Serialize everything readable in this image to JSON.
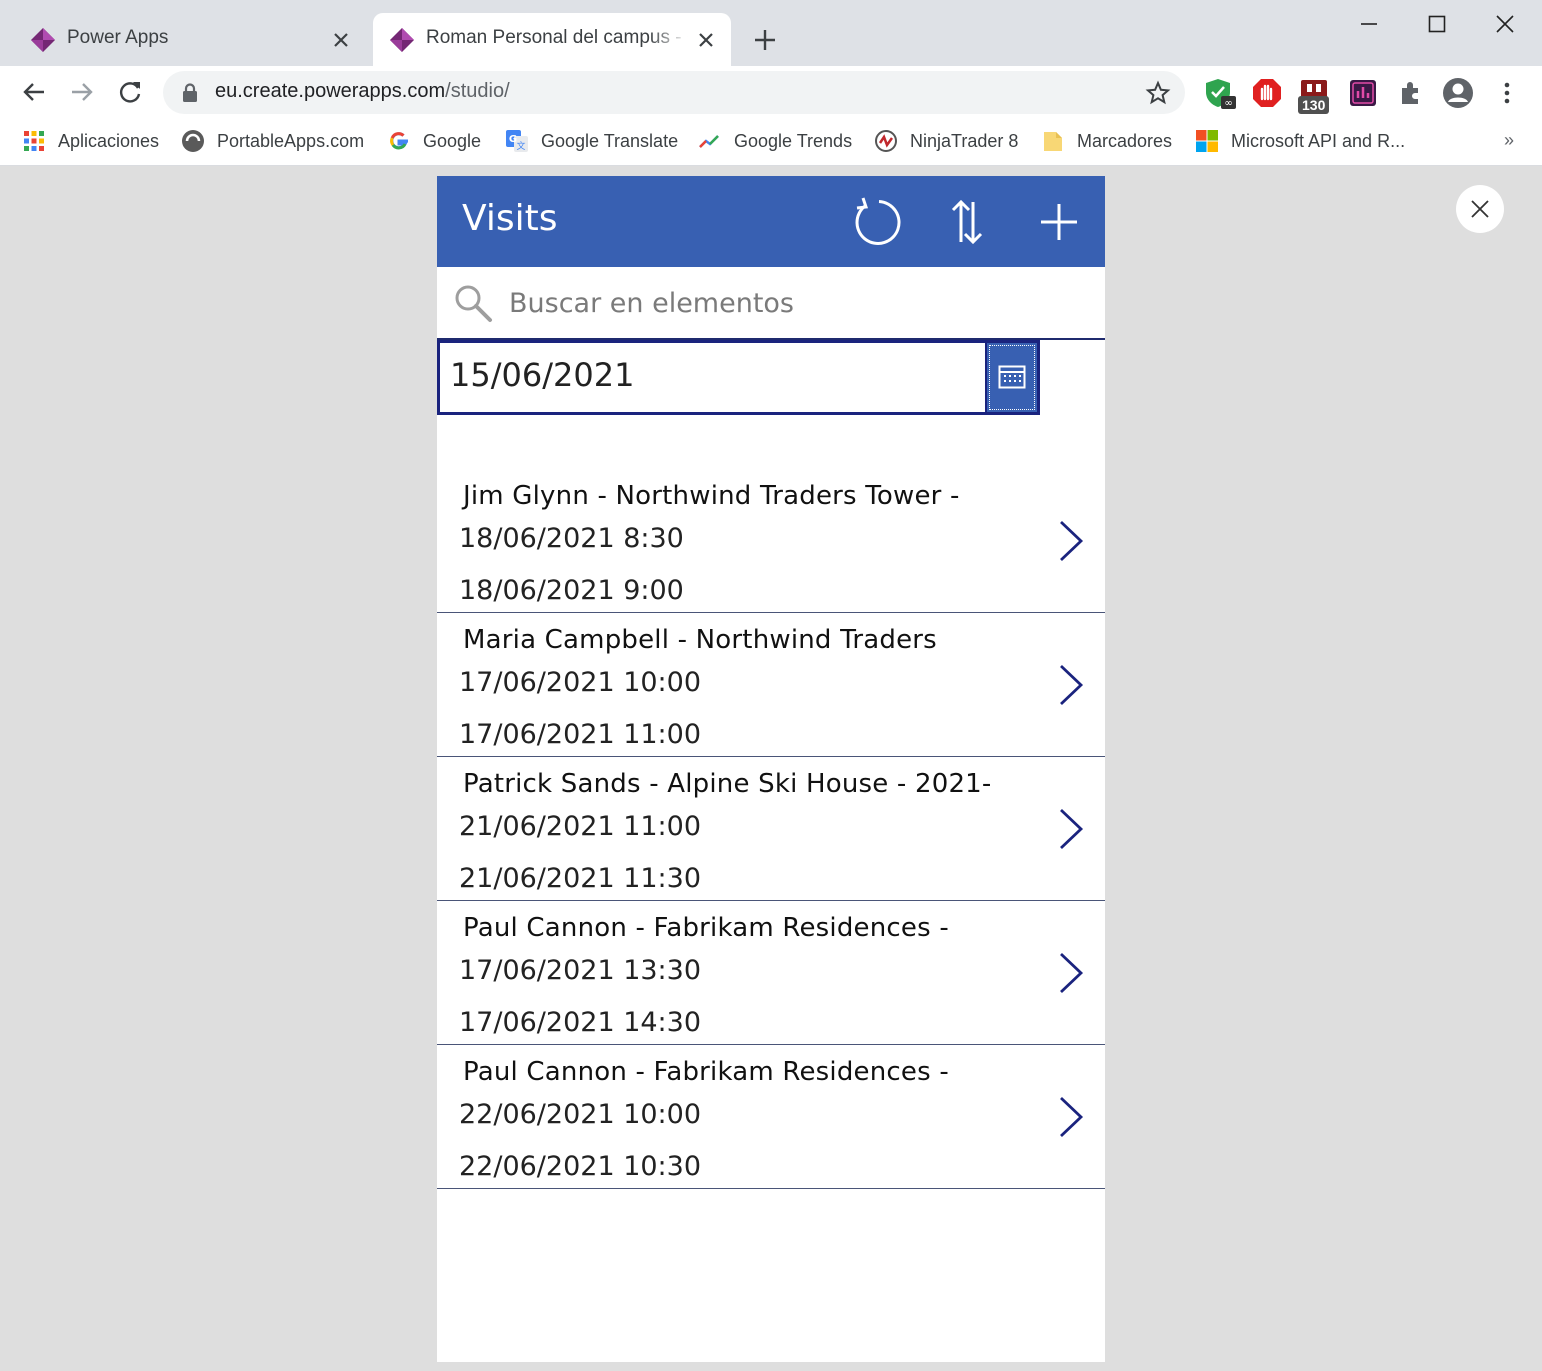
{
  "browser": {
    "tabs": [
      {
        "title": "Power Apps",
        "icon": "power-apps-icon",
        "active": false
      },
      {
        "title": "Roman Personal del campus - Gu",
        "icon": "power-apps-icon",
        "active": true
      }
    ],
    "url_host": "eu.create.powerapps.com",
    "url_path": "/studio/",
    "extension_badge": "130",
    "bookmarks": [
      {
        "label": "Aplicaciones",
        "icon": "apps-grid-icon"
      },
      {
        "label": "PortableApps.com",
        "icon": "portableapps-icon"
      },
      {
        "label": "Google",
        "icon": "google-icon"
      },
      {
        "label": "Google Translate",
        "icon": "google-translate-icon"
      },
      {
        "label": "Google Trends",
        "icon": "google-trends-icon"
      },
      {
        "label": "NinjaTrader 8",
        "icon": "ninjatrader-icon"
      },
      {
        "label": "Marcadores",
        "icon": "folder-icon"
      },
      {
        "label": "Microsoft API and R...",
        "icon": "microsoft-icon"
      }
    ],
    "bookmarks_more": "»"
  },
  "app": {
    "title": "Visits",
    "header_color": "#3860b2",
    "search_placeholder": "Buscar en elementos",
    "date_value": "15/06/2021",
    "items": [
      {
        "title": "Jim Glynn - Northwind Traders Tower -",
        "start": "18/06/2021 8:30",
        "end": "18/06/2021 9:00"
      },
      {
        "title": "Maria Campbell - Northwind Traders",
        "start": "17/06/2021 10:00",
        "end": "17/06/2021 11:00"
      },
      {
        "title": "Patrick Sands - Alpine Ski House - 2021-",
        "start": "21/06/2021 11:00",
        "end": "21/06/2021 11:30"
      },
      {
        "title": "Paul Cannon - Fabrikam Residences -",
        "start": "17/06/2021 13:30",
        "end": "17/06/2021 14:30"
      },
      {
        "title": "Paul Cannon - Fabrikam Residences -",
        "start": "22/06/2021 10:00",
        "end": "22/06/2021 10:30"
      }
    ]
  }
}
